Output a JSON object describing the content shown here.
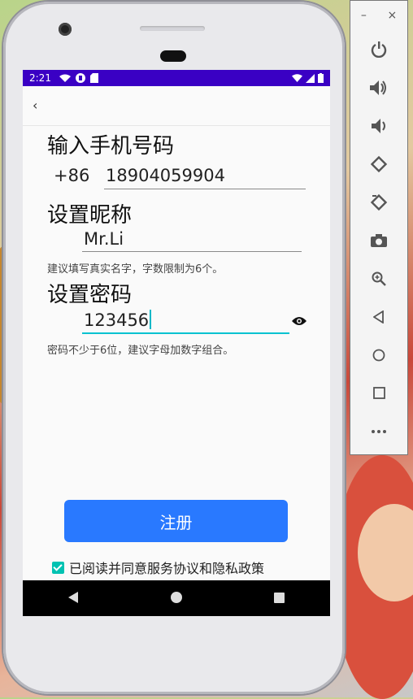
{
  "status_bar": {
    "time": "2:21"
  },
  "form": {
    "phone_heading": "输入手机号码",
    "country_code": "+86",
    "phone_value": "18904059904",
    "nickname_heading": "设置昵称",
    "nickname_value": "Mr.Li",
    "nickname_hint": "建议填写真实名字，字数限制为6个。",
    "password_heading": "设置密码",
    "password_value": "123456",
    "password_hint": "密码不少于6位，建议字母加数字组合。"
  },
  "actions": {
    "register_label": "注册",
    "agree_label": "已阅读并同意服务协议和隐私政策",
    "agree_checked": true
  },
  "colors": {
    "status_bar": "#3a00c4",
    "primary_button": "#2979ff",
    "checkbox": "#00c2b2",
    "cursor": "#00b8c8"
  },
  "emulator": {
    "controls": [
      "minimize-icon",
      "close-icon",
      "power-icon",
      "volume-up-icon",
      "volume-down-icon",
      "rotate-left-icon",
      "rotate-right-icon",
      "camera-icon",
      "zoom-icon",
      "back-icon",
      "home-icon",
      "overview-icon",
      "more-icon"
    ]
  }
}
